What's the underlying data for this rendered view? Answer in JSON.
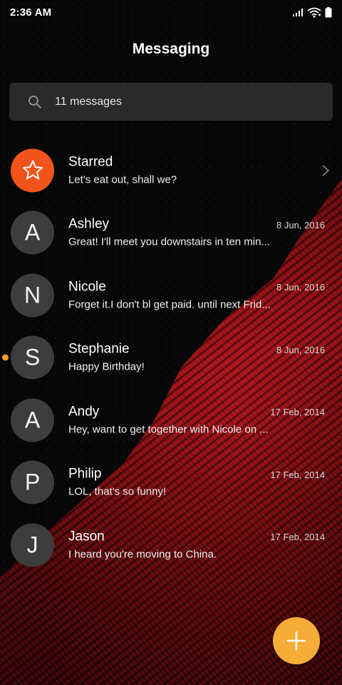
{
  "status_bar": {
    "time": "2:36 AM",
    "icons": [
      "signal-icon",
      "wifi-icon",
      "battery-icon"
    ]
  },
  "header": {
    "title": "Messaging"
  },
  "search": {
    "icon": "search-icon",
    "text": "11 messages"
  },
  "conversations": [
    {
      "avatar": "starred",
      "name": "Starred",
      "preview": "Let's eat out, shall we?",
      "date": "",
      "chevron": true,
      "unread": false
    },
    {
      "avatar": "A",
      "name": "Ashley",
      "preview": "Great! I'll meet you downstairs in ten min...",
      "date": "8 Jun, 2016",
      "unread": false
    },
    {
      "avatar": "N",
      "name": "Nicole",
      "preview": "Forget it.I don't bl get paid. until next Frid...",
      "date": "8 Jun, 2016",
      "unread": false
    },
    {
      "avatar": "S",
      "name": "Stephanie",
      "preview": "Happy Birthday!",
      "date": "8 Jun, 2016",
      "unread": true
    },
    {
      "avatar": "A",
      "name": "Andy",
      "preview": "Hey, want to get together with Nicole on ...",
      "date": "17 Feb, 2014",
      "unread": false
    },
    {
      "avatar": "P",
      "name": "Philip",
      "preview": "LOL, that's so funny!",
      "date": "17 Feb, 2014",
      "unread": false
    },
    {
      "avatar": "J",
      "name": "Jason",
      "preview": "I heard you're moving to China.",
      "date": "17 Feb, 2014",
      "unread": false
    }
  ],
  "fab": {
    "icon": "plus-icon"
  },
  "colors": {
    "starred_avatar": "#f2541b",
    "avatar_bg": "#3d3d3d",
    "unread_dot": "#f39a2c",
    "fab": "#f6ad37",
    "search_bg": "#2a2a2a",
    "wallpaper_accent": "#a3121a"
  }
}
